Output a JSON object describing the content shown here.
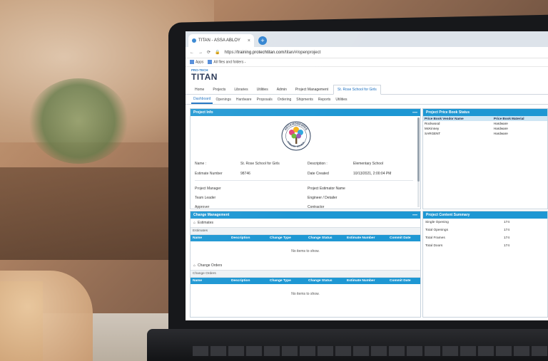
{
  "browser": {
    "tab_title": "TITAN - ASSA ABLOY",
    "new_tab_icon": "plus-icon",
    "url_prefix": "https://",
    "url_host": "training.protechtitan.com",
    "url_path": "/titan/#/openproject",
    "bookmark_apps": "Apps",
    "bookmark_folder": "All files and folders -"
  },
  "brand": {
    "small": "PRO-TECH",
    "big": "TITAN"
  },
  "main_nav": [
    "Home",
    "Projects",
    "Libraries",
    "Utilities",
    "Admin",
    "Project Management",
    "St. Rose School for Girls"
  ],
  "sub_nav": [
    "Dashboard",
    "Openings",
    "Hardware",
    "Proposals",
    "Ordering",
    "Shipments",
    "Reports",
    "Utilities"
  ],
  "project_info": {
    "title": "Project Info",
    "collapse": "—",
    "logo_text_top": "HECKMONDWIKE",
    "logo_text_bottom": "PRIMARY SCHOOL",
    "name_label": "Name :",
    "name_value": "St. Rose School for Girls",
    "description_label": "Description :",
    "description_value": "Elementary School",
    "estimate_label": "Estimate Number",
    "estimate_value": "98746",
    "date_label": "Date Created",
    "date_value": "10/13/2021, 2:00:04 PM",
    "project_manager_label": "Project Manager",
    "project_estimator_label": "Project Estimator Name",
    "team_leader_label": "Team Leader",
    "engineer_label": "Engineer / Detailer",
    "approver_label": "Approver",
    "contractor_label": "Contractor"
  },
  "price_book": {
    "title": "Project Price Book Status",
    "headers": [
      "Price Book Vendor Name",
      "Price Book Material"
    ],
    "rows": [
      [
        "Rockwood",
        "Hardware"
      ],
      [
        "McKinney",
        "Hardware"
      ],
      [
        "SARGENT",
        "Hardware"
      ]
    ]
  },
  "change_management": {
    "title": "Change Management",
    "collapse": "—",
    "estimates_section": "Estimates",
    "estimates_sub": "Estimates",
    "change_orders_section": "Change Orders",
    "change_orders_sub": "Change Orders",
    "headers": [
      "Name",
      "Description",
      "Change Type",
      "Change Status",
      "Estimate Number",
      "Commit Date"
    ],
    "empty_text": "No items to show."
  },
  "content_summary": {
    "title": "Project Content Summary",
    "rows": [
      [
        "Single Opening",
        "174"
      ],
      [
        "Total Openings",
        "174"
      ],
      [
        "Total Frames",
        "174"
      ],
      [
        "Total Doors",
        "174"
      ]
    ]
  },
  "colors": {
    "accent": "#1e97d3",
    "brand_dark": "#1b2a4a",
    "link": "#1a6fc0"
  }
}
